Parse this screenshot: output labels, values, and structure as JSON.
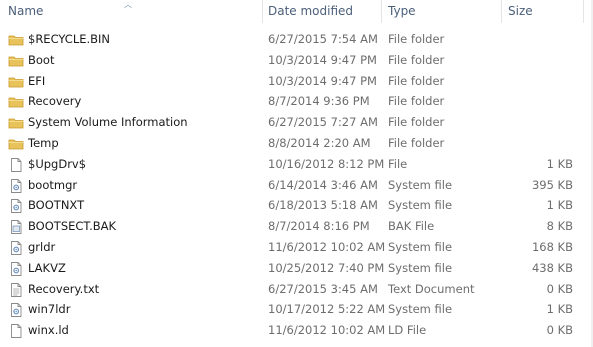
{
  "columns": {
    "name": "Name",
    "date": "Date modified",
    "type": "Type",
    "size": "Size"
  },
  "files": [
    {
      "name": "$RECYCLE.BIN",
      "date": "6/27/2015 7:54 AM",
      "type": "File folder",
      "size": "",
      "icon": "folder-icon"
    },
    {
      "name": "Boot",
      "date": "10/3/2014 9:47 PM",
      "type": "File folder",
      "size": "",
      "icon": "folder-icon"
    },
    {
      "name": "EFI",
      "date": "10/3/2014 9:47 PM",
      "type": "File folder",
      "size": "",
      "icon": "folder-icon"
    },
    {
      "name": "Recovery",
      "date": "8/7/2014 9:36 PM",
      "type": "File folder",
      "size": "",
      "icon": "folder-icon"
    },
    {
      "name": "System Volume Information",
      "date": "6/27/2015 7:27 AM",
      "type": "File folder",
      "size": "",
      "icon": "folder-icon"
    },
    {
      "name": "Temp",
      "date": "8/8/2014 2:20 AM",
      "type": "File folder",
      "size": "",
      "icon": "folder-icon"
    },
    {
      "name": "$UpgDrv$",
      "date": "10/16/2012 8:12 PM",
      "type": "File",
      "size": "1 KB",
      "icon": "file-icon"
    },
    {
      "name": "bootmgr",
      "date": "6/14/2014 3:46 AM",
      "type": "System file",
      "size": "395 KB",
      "icon": "system-file-icon"
    },
    {
      "name": "BOOTNXT",
      "date": "6/18/2013 5:18 AM",
      "type": "System file",
      "size": "1 KB",
      "icon": "system-file-icon"
    },
    {
      "name": "BOOTSECT.BAK",
      "date": "8/7/2014 8:16 PM",
      "type": "BAK File",
      "size": "8 KB",
      "icon": "bak-file-icon"
    },
    {
      "name": "grldr",
      "date": "11/6/2012 10:02 AM",
      "type": "System file",
      "size": "168 KB",
      "icon": "system-file-icon"
    },
    {
      "name": "LAKVZ",
      "date": "10/25/2012 7:40 PM",
      "type": "System file",
      "size": "438 KB",
      "icon": "system-file-icon"
    },
    {
      "name": "Recovery.txt",
      "date": "6/27/2015 3:45 AM",
      "type": "Text Document",
      "size": "0 KB",
      "icon": "text-file-icon"
    },
    {
      "name": "win7ldr",
      "date": "10/17/2012 5:22 AM",
      "type": "System file",
      "size": "1 KB",
      "icon": "system-file-icon"
    },
    {
      "name": "winx.ld",
      "date": "11/6/2012 10:02 AM",
      "type": "LD File",
      "size": "0 KB",
      "icon": "file-icon"
    }
  ],
  "colors": {
    "folder": "#e8c25a",
    "folder_dark": "#c89a2a",
    "header_text": "#4c607a",
    "secondary_text": "#6d6d6d"
  }
}
